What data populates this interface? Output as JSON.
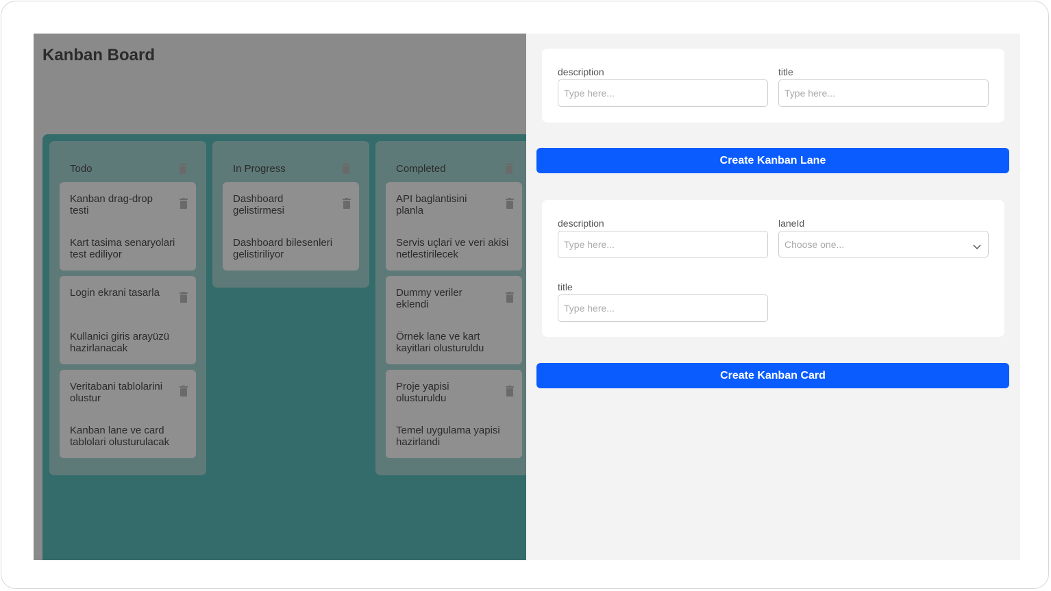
{
  "board": {
    "title": "Kanban Board",
    "lanes": [
      {
        "title": "Todo",
        "cards": [
          {
            "title": "Kanban drag-drop testi",
            "description": "Kart tasima senaryolari test ediliyor"
          },
          {
            "title": "Login ekrani tasarla",
            "description": "Kullanici giris arayüzü hazirlanacak"
          },
          {
            "title": "Veritabani tablolarini olustur",
            "description": "Kanban lane ve card tablolari olusturulacak"
          }
        ]
      },
      {
        "title": "In Progress",
        "cards": [
          {
            "title": "Dashboard gelistirmesi",
            "description": "Dashboard bilesenleri gelistiriliyor"
          }
        ]
      },
      {
        "title": "Completed",
        "cards": [
          {
            "title": "API baglantisini planla",
            "description": "Servis uçlari ve veri akisi netlestirilecek"
          },
          {
            "title": "Dummy veriler eklendi",
            "description": "Örnek lane ve kart kayitlari olusturuldu"
          },
          {
            "title": "Proje yapisi olusturuldu",
            "description": "Temel uygulama yapisi hazirlandi"
          }
        ]
      }
    ]
  },
  "lane_form": {
    "description_label": "description",
    "description_placeholder": "Type here...",
    "title_label": "title",
    "title_placeholder": "Type here...",
    "submit_label": "Create Kanban Lane"
  },
  "card_form": {
    "description_label": "description",
    "description_placeholder": "Type here...",
    "lane_label": "laneId",
    "lane_placeholder": "Choose one...",
    "title_label": "title",
    "title_placeholder": "Type here...",
    "submit_label": "Create Kanban Card"
  },
  "colors": {
    "accent": "#0a5cff",
    "board_area": "#336c6a",
    "overlay": "#8a8a8a"
  },
  "icons": {
    "delete": "trash-icon",
    "select": "chevron-down-icon"
  }
}
